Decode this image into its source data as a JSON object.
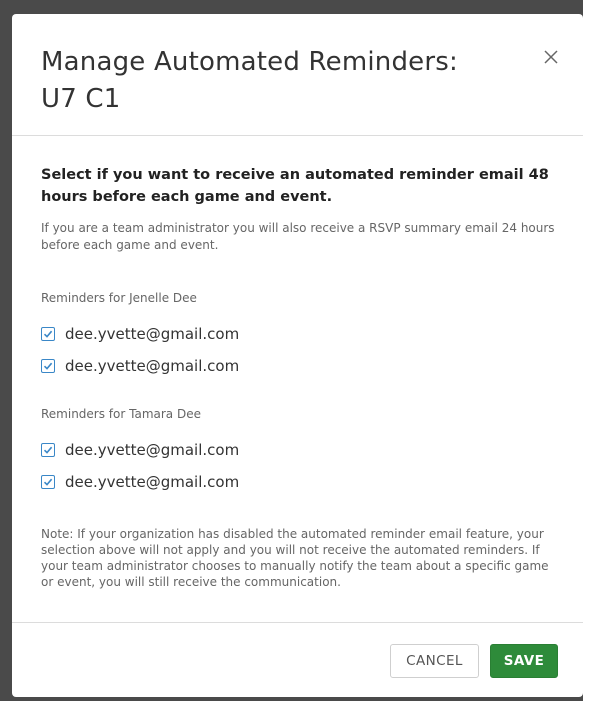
{
  "modal": {
    "title": "Manage Automated Reminders: U7 C1",
    "close_icon": "close-icon",
    "lead": "Select if you want to receive an automated reminder email 48 hours before each game and event.",
    "admin_note": "If you are a team administrator you will also receive a RSVP summary email 24 hours before each game and event.",
    "groups": [
      {
        "label": "Reminders for Jenelle Dee",
        "emails": [
          {
            "address": "dee.yvette@gmail.com",
            "checked": true
          },
          {
            "address": "dee.yvette@gmail.com",
            "checked": true
          }
        ]
      },
      {
        "label": "Reminders for Tamara Dee",
        "emails": [
          {
            "address": "dee.yvette@gmail.com",
            "checked": true
          },
          {
            "address": "dee.yvette@gmail.com",
            "checked": true
          }
        ]
      }
    ],
    "footnote": "Note: If your organization has disabled the automated reminder email feature, your selection above will not apply and you will not receive the automated reminders. If your team administrator chooses to manually notify the team about a specific game or event, you will still receive the communication.",
    "cancel_label": "CANCEL",
    "save_label": "SAVE"
  },
  "colors": {
    "backdrop": "#4a4a4a",
    "save_button": "#2e8b3a",
    "checkbox_accent": "#3a87c7"
  }
}
